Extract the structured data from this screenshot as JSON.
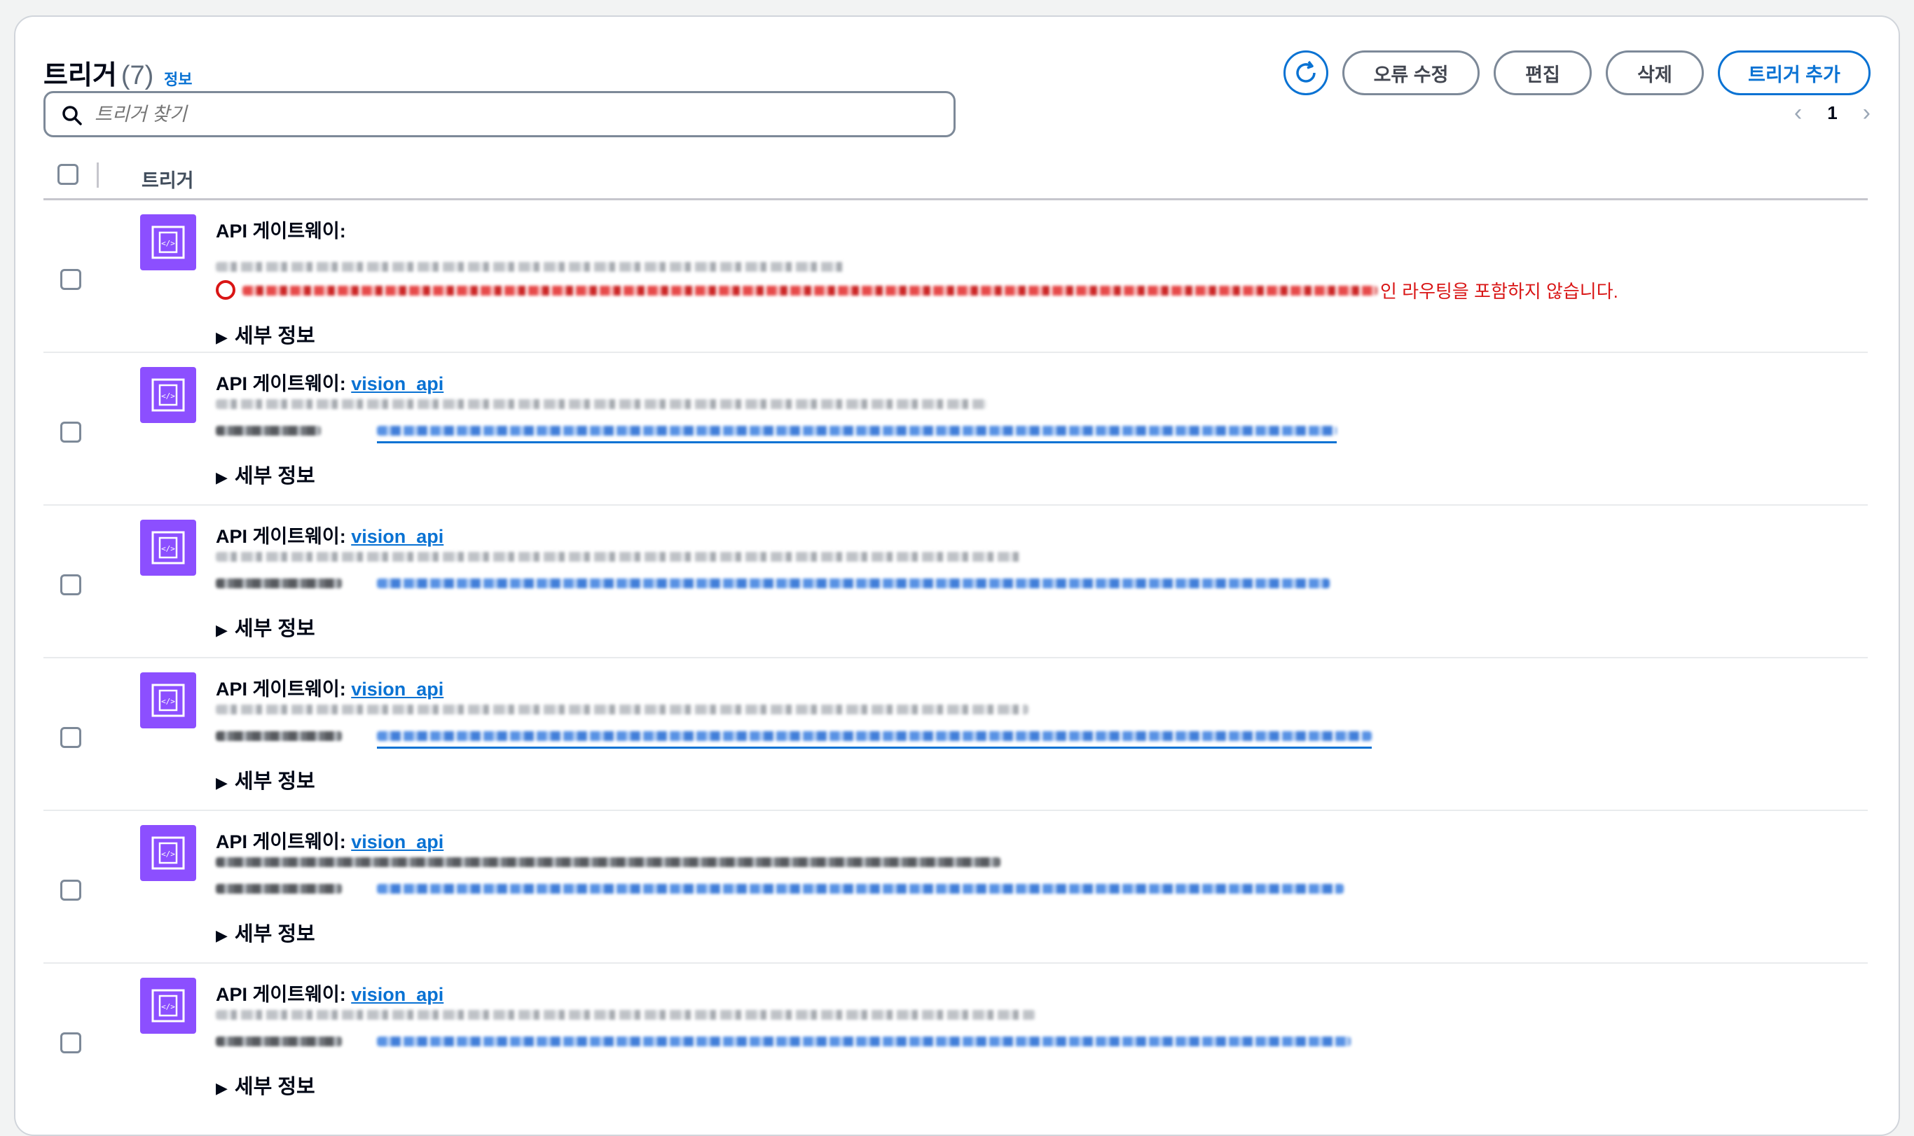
{
  "header": {
    "title": "트리거",
    "count": "(7)",
    "info": "정보",
    "buttons": {
      "fix_errors": "오류 수정",
      "edit": "편집",
      "delete": "삭제",
      "add_trigger": "트리거 추가"
    }
  },
  "search": {
    "placeholder": "트리거 찾기"
  },
  "pagination": {
    "page": "1"
  },
  "table": {
    "column": "트리거"
  },
  "rows": [
    {
      "label": "API 게이트웨이:",
      "link": "",
      "error_tail": "인 라우팅을 포함하지 않습니다.",
      "details": "세부 정보"
    },
    {
      "label": "API 게이트웨이:",
      "link": "vision_api",
      "details": "세부 정보"
    },
    {
      "label": "API 게이트웨이:",
      "link": "vision_api",
      "details": "세부 정보"
    },
    {
      "label": "API 게이트웨이:",
      "link": "vision_api",
      "details": "세부 정보"
    },
    {
      "label": "API 게이트웨이:",
      "link": "vision_api",
      "details": "세부 정보"
    },
    {
      "label": "API 게이트웨이:",
      "link": "vision_api",
      "details": "세부 정보"
    }
  ],
  "colors": {
    "accent": "#0972d3",
    "error": "#d91515",
    "service_icon": "#8c4fff"
  },
  "icons": [
    "refresh-icon",
    "search-icon",
    "chevron-left-icon",
    "chevron-right-icon",
    "api-gateway-icon",
    "error-icon",
    "caret-right-icon"
  ]
}
